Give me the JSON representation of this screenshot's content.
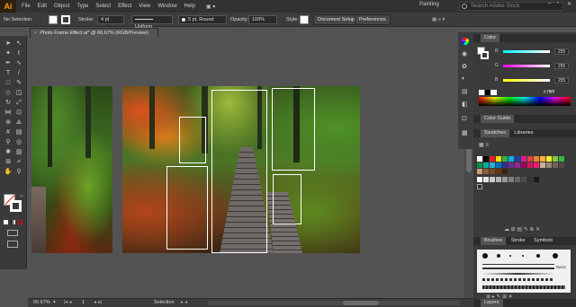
{
  "app": {
    "logo": "Ai"
  },
  "menu": [
    "File",
    "Edit",
    "Object",
    "Type",
    "Select",
    "Effect",
    "View",
    "Window",
    "Help"
  ],
  "workspace": "Painting",
  "search": {
    "placeholder": "Search Adobe Stock"
  },
  "control_bar": {
    "selection_label": "No Selection",
    "stroke_label": "Stroke:",
    "stroke_weight": "4 pt",
    "stroke_profile": "Uniform",
    "brush_label": "5 pt. Round",
    "opacity_label": "Opacity:",
    "opacity_value": "100%",
    "style_label": "Style:",
    "document_setup": "Document Setup",
    "preferences": "Preferences"
  },
  "document": {
    "tab_title": "Photo Frame Effect.ai* @ 66.67% (RGB/Preview)",
    "close": "×"
  },
  "status": {
    "zoom": "66.67%",
    "artboard": "1",
    "tool": "Selection"
  },
  "color_panel": {
    "title": "Color",
    "r_value": "255",
    "g_value": "255",
    "b_value": "255",
    "hex": "ffffff",
    "accent": "#ffffff"
  },
  "color_guide": {
    "title": "Color Guide"
  },
  "swatches": {
    "tabs": [
      "Swatches",
      "Libraries"
    ]
  },
  "brushes": {
    "tabs": [
      "Brushes",
      "Stroke",
      "Symbols"
    ],
    "basic": "Basic"
  },
  "layers": {
    "title": "Layers"
  },
  "tools": [
    "selection-tool",
    "direct-selection-tool",
    "magic-wand-tool",
    "lasso-tool",
    "pen-tool",
    "curvature-tool",
    "type-tool",
    "line-tool",
    "rectangle-tool",
    "paintbrush-tool",
    "shaper-tool",
    "pencil-tool",
    "eraser-tool",
    "rotate-tool",
    "scale-tool",
    "width-tool",
    "free-transform-tool",
    "shape-builder-tool",
    "perspective-grid-tool",
    "mesh-tool",
    "gradient-tool",
    "eyedropper-tool",
    "blend-tool",
    "symbol-sprayer-tool",
    "column-graph-tool",
    "artboard-tool",
    "slice-tool",
    "hand-tool",
    "zoom-tool"
  ]
}
